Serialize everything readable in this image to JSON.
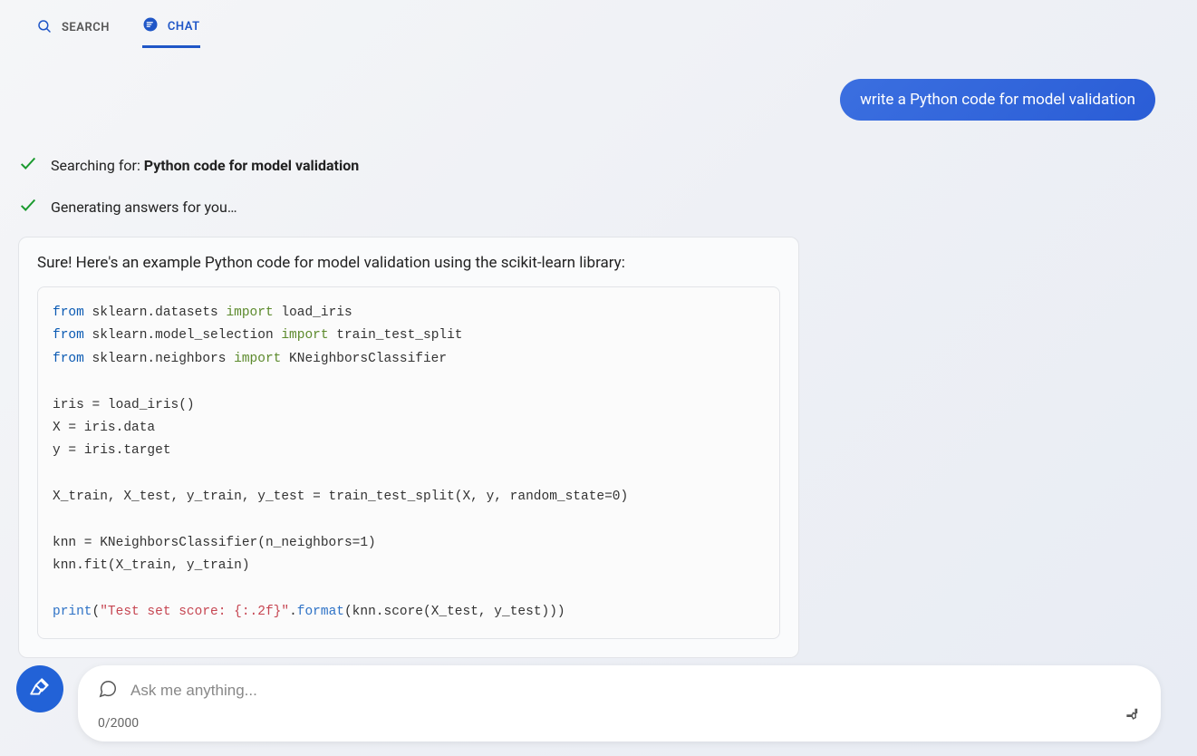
{
  "tabs": {
    "search": "SEARCH",
    "chat": "CHAT"
  },
  "user_message": "write a Python code for model validation",
  "status": {
    "searching_prefix": "Searching for: ",
    "searching_query": "Python code for model validation",
    "generating": "Generating answers for you…"
  },
  "answer": {
    "intro": "Sure! Here's an example Python code for model validation using the scikit-learn library:",
    "code": {
      "l1_from": "from",
      "l1_mod": " sklearn.datasets ",
      "l1_import": "import",
      "l1_rest": " load_iris",
      "l2_from": "from",
      "l2_mod": " sklearn.model_selection ",
      "l2_import": "import",
      "l2_rest": " train_test_split",
      "l3_from": "from",
      "l3_mod": " sklearn.neighbors ",
      "l3_import": "import",
      "l3_rest": " KNeighborsClassifier",
      "l5": "iris = load_iris()",
      "l6": "X = iris.data",
      "l7": "y = iris.target",
      "l9": "X_train, X_test, y_train, y_test = train_test_split(X, y, random_state=0)",
      "l11": "knn = KNeighborsClassifier(n_neighbors=1)",
      "l12": "knn.fit(X_train, y_train)",
      "l14_print": "print",
      "l14_open": "(",
      "l14_str": "\"Test set score: {:.2f}\"",
      "l14_dot": ".",
      "l14_format": "format",
      "l14_rest": "(knn.score(X_test, y_test)))"
    }
  },
  "input": {
    "placeholder": "Ask me anything...",
    "char_count": "0/2000"
  }
}
